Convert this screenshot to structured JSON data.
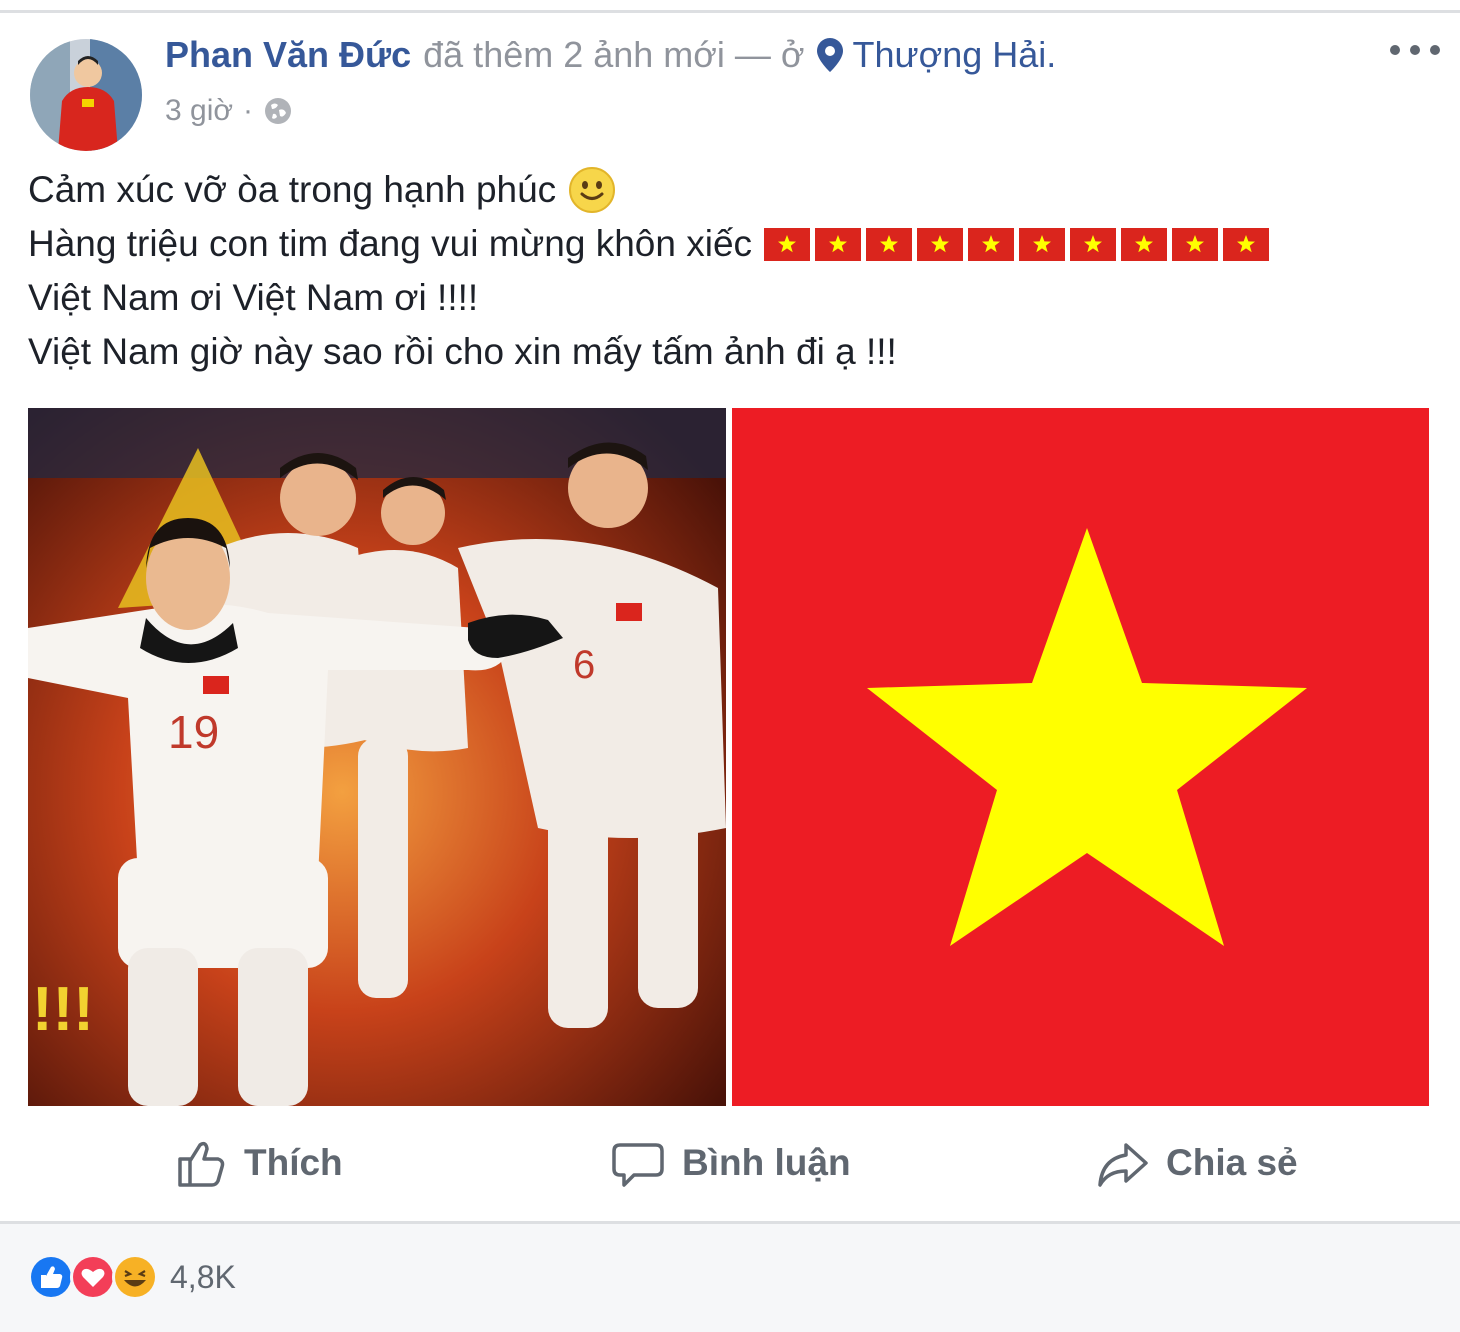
{
  "post": {
    "author": "Phan Văn Đức",
    "action_text": "đã thêm 2 ảnh mới — ở",
    "location": "Thượng Hải.",
    "time": "3 giờ",
    "separator": "·",
    "caption": [
      "Cảm xúc vỡ òa trong hạnh phúc",
      "Hàng triệu con tim đang vui mừng khôn xiếc",
      "Việt Nam ơi Việt Nam ơi !!!!",
      "Việt Nam giờ này sao rồi cho xin mấy tấm ảnh đi ạ !!!"
    ],
    "emoji_flag_count": 10,
    "photo_overlay_text": "!!!",
    "jersey_numbers": [
      "19",
      "6"
    ]
  },
  "actions": {
    "like": "Thích",
    "comment": "Bình luận",
    "share": "Chia sẻ"
  },
  "reactions": {
    "types": [
      "like-icon",
      "love-icon",
      "haha-icon"
    ],
    "count": "4,8K"
  },
  "colors": {
    "link": "#365899",
    "muted": "#90949c",
    "flag_red": "#da251d",
    "flag_yellow": "#ffff00",
    "like_blue": "#1877f2",
    "love_red": "#f33e58",
    "haha_yellow": "#f7b125"
  }
}
